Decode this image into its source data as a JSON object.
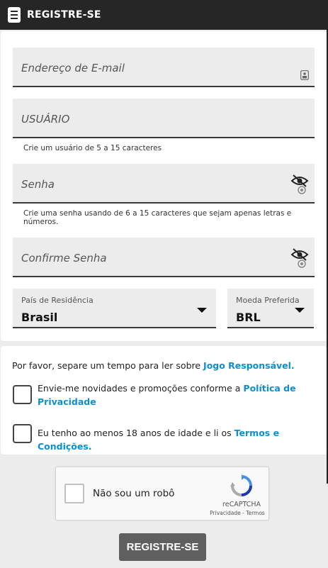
{
  "header": {
    "title": "REGISTRE-SE",
    "icon": "form-document-icon"
  },
  "form": {
    "email": {
      "placeholder": "Endereço de E-mail",
      "icon": "id-card-icon"
    },
    "username": {
      "placeholder": "USUÁRIO",
      "hint": "Crie um usuário de 5 a 15 caracteres"
    },
    "password": {
      "placeholder": "Senha",
      "hint": "Crie uma senha usando de 6 a 15 caracteres que sejam apenas letras e números.",
      "icon": "eye-off-icon"
    },
    "confirm": {
      "placeholder": "Confirme Senha",
      "icon": "eye-off-icon"
    },
    "country": {
      "label": "País de Residência",
      "value": "Brasil"
    },
    "currency": {
      "label": "Moeda Preferida",
      "value": "BRL"
    }
  },
  "consent": {
    "intro": "Por favor, separe um tempo para ler sobre",
    "intro_link": "Jogo Responsável.",
    "newsletter_text": "Envie-me novidades e promoções conforme a",
    "newsletter_link": "Política de Privacidade",
    "age_text": "Eu tenho ao menos 18 anos de idade e li os",
    "age_link": "Termos e Condições."
  },
  "captcha": {
    "label": "Não sou um robô",
    "brand": "reCAPTCHA",
    "terms": "Privacidade - Termos"
  },
  "submit_label": "REGISTRE-SE",
  "colors": {
    "header_bg": "#262626",
    "link": "#0b8fcf",
    "button_bg": "#5f5f5f"
  }
}
